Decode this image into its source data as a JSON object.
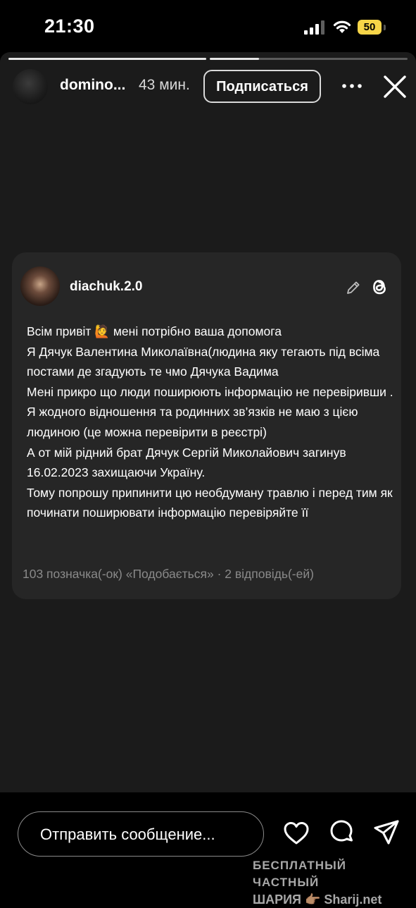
{
  "status_bar": {
    "time": "21:30",
    "battery_level": "50",
    "icons": [
      "cellular-signal-icon",
      "wifi-icon",
      "battery-icon"
    ],
    "battery_color": "#f7d548"
  },
  "story": {
    "progress": [
      1.0,
      0.25,
      0.0
    ],
    "header": {
      "username": "domino...",
      "time_ago": "43 мин.",
      "follow_label": "Подписаться",
      "icons": [
        "more-icon",
        "close-icon"
      ]
    },
    "card": {
      "username": "diachuk.2.0",
      "icons": [
        "pencil-icon",
        "threads-logo-icon"
      ],
      "paragraphs": [
        "Всім привіт 🙋 мені потрібно ваша допомога",
        "Я Дячук Валентина Миколаївна(людина яку тегають під всіма постами де згадують те чмо Дячука Вадима",
        "Мені прикро що люди поширюють інформацію не перевіривши .",
        "Я жодного відношення та родинних зв’язків не маю з цією людиною (це можна перевірити в реєстрі)",
        "А от мій рідний брат Дячук Сергій Миколайович загинув 16.02.2023 захищаючи Україну.",
        "Тому попрошу припинити цю необдуману травлю і перед тим як починати поширювати інформацію перевіряйте її"
      ],
      "footer": "103 позначка(-ок) «Подобається» · 2 відповідь(-ей)"
    }
  },
  "reply_bar": {
    "placeholder": "Отправить сообщение...",
    "icons": [
      "heart-icon",
      "comment-icon",
      "send-icon"
    ]
  },
  "watermark": {
    "line1": "БЕСПЛАТНЫЙ ЧАСТНЫЙ",
    "line2": "ШАРИЯ 👉🏽 Sharij.net"
  }
}
